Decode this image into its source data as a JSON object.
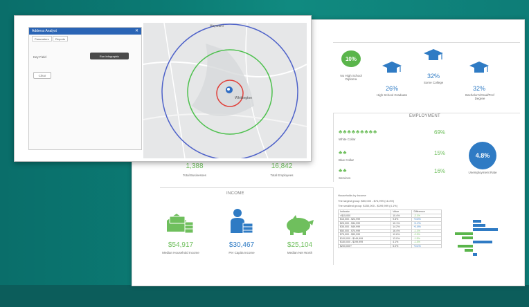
{
  "map": {
    "place_label_top": "Hayward",
    "place_label_center": "Whittington"
  },
  "panel": {
    "title": "Address Analyst",
    "tab_1": "Parameters",
    "tab_2": "Reports",
    "label": "Key Field",
    "run_button": "Run Infographic",
    "clear_button": "Clear"
  },
  "education": {
    "badge": "10%",
    "badge_label": "No High School Diploma",
    "hs_value": "26%",
    "hs_label": "High School Graduate",
    "college_value": "32%",
    "college_label": "Some College",
    "bachelor_value": "32%",
    "bachelor_label": "Bachelor's/Grad/Prof Degree"
  },
  "employment": {
    "title": "EMPLOYMENT",
    "white_collar_pct": "69%",
    "white_collar_label": "White Collar",
    "blue_collar_pct": "15%",
    "blue_collar_label": "Blue Collar",
    "services_pct": "16%",
    "services_label": "Services",
    "unemployment_rate": "4.8%",
    "unemployment_label": "Unemployment Rate"
  },
  "business": {
    "total_businesses": "1,388",
    "total_businesses_label": "Total Businesses",
    "total_employees": "16,842",
    "total_employees_label": "Total Employees"
  },
  "income": {
    "title": "INCOME",
    "median_household": "$54,917",
    "median_household_label": "Median Household Income",
    "per_capita": "$30,467",
    "per_capita_label": "Per Capita Income",
    "net_worth": "$25,104",
    "net_worth_label": "Median Net Worth"
  },
  "table": {
    "caption_1": "Households by Income",
    "caption_2": "The largest group: $50,000 - $74,999 (16.4%)",
    "caption_3": "The smallest group: $150,000 - $199,999 (4.1%)",
    "headers": [
      "Indicator",
      "Value",
      "Difference"
    ],
    "rows": [
      [
        "<$15,000",
        "10.4%",
        "-2.1%"
      ],
      [
        "$15,000 - $24,999",
        "9.8%",
        "+0.6%"
      ],
      [
        "$25,000 - $34,999",
        "10.1%",
        "+1.2%"
      ],
      [
        "$35,000 - $49,999",
        "14.2%",
        "+1.8%"
      ],
      [
        "$50,000 - $74,999",
        "16.4%",
        "-1.1%"
      ],
      [
        "$75,000 - $99,999",
        "12.6%",
        "-2.9%"
      ],
      [
        "$100,000 - $149,999",
        "13.0%",
        "-1.5%"
      ],
      [
        "$150,000 - $199,999",
        "4.1%",
        "-1.3%"
      ],
      [
        "$200,000+",
        "5.0%",
        "+0.4%"
      ]
    ]
  },
  "colors": {
    "green": "#6fbf5d",
    "blue": "#2f7bc4",
    "panel_header": "#2a64b5"
  }
}
